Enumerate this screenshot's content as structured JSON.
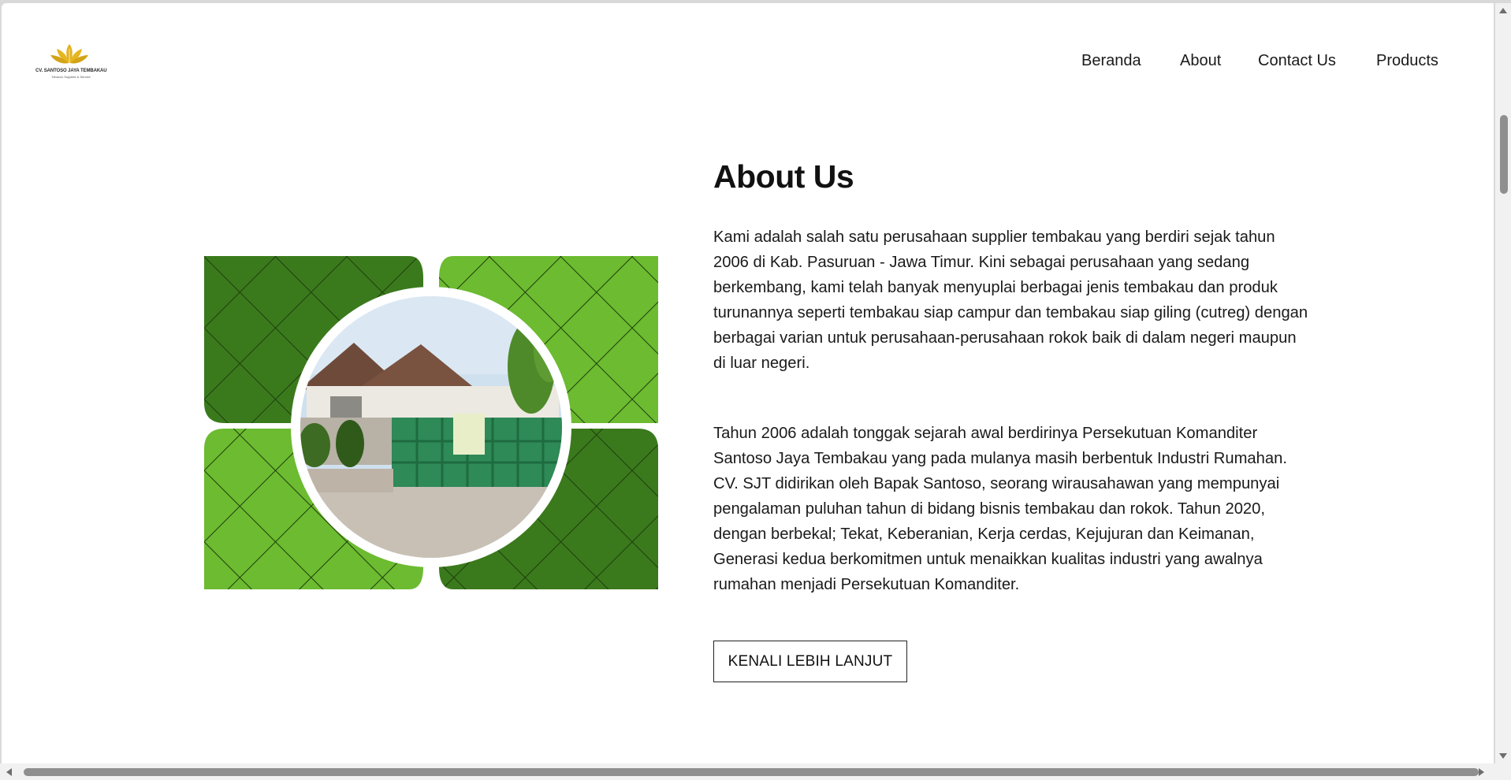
{
  "brand": {
    "name": "CV. SANTOSO JAYA TEMBAKAU",
    "tagline": "Tobacco Supplies & Service"
  },
  "nav": {
    "items": [
      {
        "label": "Beranda"
      },
      {
        "label": "About"
      },
      {
        "label": "Contact Us"
      },
      {
        "label": "Products"
      }
    ]
  },
  "about": {
    "title": "About Us",
    "paragraph1": "Kami adalah salah satu perusahaan supplier tembakau yang berdiri sejak tahun 2006 di Kab. Pasuruan - Jawa Timur. Kini sebagai perusahaan yang sedang berkembang, kami telah banyak menyuplai berbagai jenis tembakau dan produk turunannya seperti tembakau siap campur dan tembakau siap giling (cutreg) dengan berbagai varian untuk perusahaan-perusahaan rokok baik di dalam negeri maupun di luar negeri.",
    "paragraph2": "Tahun 2006 adalah tonggak sejarah awal berdirinya Persekutuan Komanditer Santoso Jaya Tembakau yang pada mulanya masih berbentuk Industri Rumahan. CV. SJT didirikan oleh Bapak Santoso, seorang wirausahawan yang mempunyai pengalaman puluhan tahun di bidang bisnis tembakau dan rokok. Tahun 2020, dengan berbekal; Tekat, Keberanian, Kerja cerdas, Kejujuran dan Keimanan, Generasi kedua berkomitmen untuk menaikkan kualitas industri yang awalnya rumahan menjadi Persekutuan Komanditer.",
    "cta_label": "KENALI LEBIH LANJUT"
  },
  "colors": {
    "green_dark": "#3a7a1c",
    "green_light": "#6cbb30",
    "logo_gold": "#e3b21f"
  },
  "icons": {
    "logo": "tobacco-leaf-logo-icon"
  }
}
